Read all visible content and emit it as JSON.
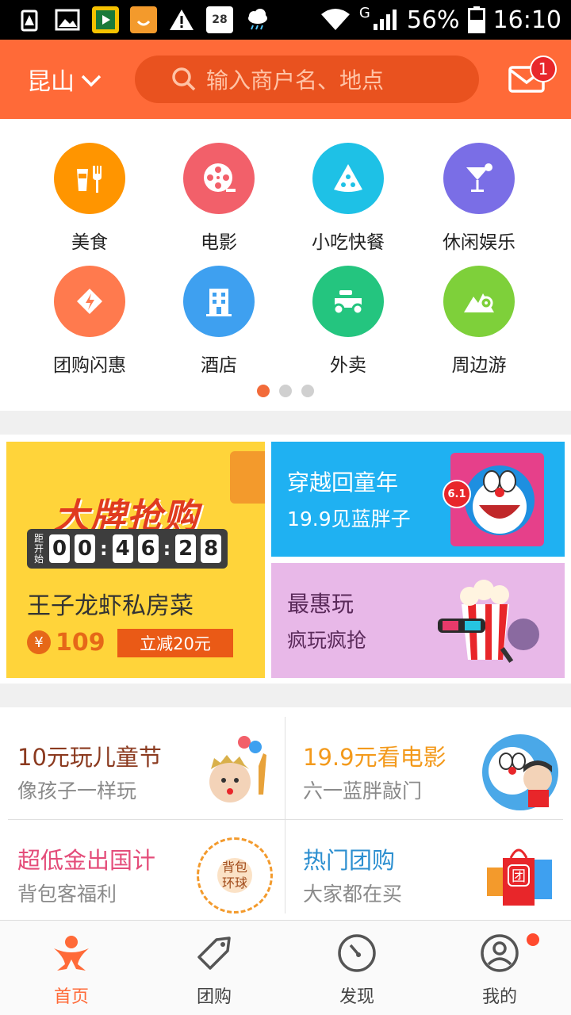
{
  "status_bar": {
    "signal": "G",
    "battery": "56%",
    "time": "16:10"
  },
  "header": {
    "city": "昆山",
    "search_placeholder": "输入商户名、地点",
    "mail_badge": "1"
  },
  "categories": [
    {
      "label": "美食",
      "icon": "food-icon",
      "color": "#ff9500"
    },
    {
      "label": "电影",
      "icon": "film-reel-icon",
      "color": "#f2606a"
    },
    {
      "label": "小吃快餐",
      "icon": "pizza-icon",
      "color": "#1ec1e6"
    },
    {
      "label": "休闲娱乐",
      "icon": "cocktail-icon",
      "color": "#7a6ee6"
    },
    {
      "label": "团购闪惠",
      "icon": "flash-tag-icon",
      "color": "#ff7a4e"
    },
    {
      "label": "酒店",
      "icon": "hotel-icon",
      "color": "#3ea0f0"
    },
    {
      "label": "外卖",
      "icon": "scooter-icon",
      "color": "#24c57f"
    },
    {
      "label": "周边游",
      "icon": "mountain-pin-icon",
      "color": "#7ed03a"
    }
  ],
  "pager": {
    "pages": 3,
    "active": 1
  },
  "promo": {
    "flash": {
      "title": "大牌抢购",
      "timer_label": "距开始",
      "hours": [
        "0",
        "0"
      ],
      "minutes": [
        "4",
        "6"
      ],
      "seconds": [
        "2",
        "8"
      ],
      "dish": "王子龙虾私房菜",
      "currency": "¥",
      "price": "109",
      "discount": "立减20元"
    },
    "blue": {
      "title": "穿越回童年",
      "subtitle": "19.9见蓝胖子",
      "badge": "6.1"
    },
    "pink": {
      "title": "最惠玩",
      "subtitle": "疯玩疯抢"
    }
  },
  "grid": [
    {
      "title": "10元玩儿童节",
      "subtitle": "像孩子一样玩",
      "title_color": "#8b3a1f"
    },
    {
      "title": "19.9元看电影",
      "subtitle": "六一蓝胖敲门",
      "title_color": "#f39a1c"
    },
    {
      "title": "超低金出国计",
      "subtitle": "背包客福利",
      "title_color": "#e44d7a",
      "image_text": "背包环球"
    },
    {
      "title": "热门团购",
      "subtitle": "大家都在买",
      "title_color": "#2c8fd0",
      "image_text": "团"
    }
  ],
  "tabs": [
    {
      "label": "首页",
      "icon": "home-person-icon",
      "active": true
    },
    {
      "label": "团购",
      "icon": "tag-icon",
      "active": false
    },
    {
      "label": "发现",
      "icon": "compass-icon",
      "active": false
    },
    {
      "label": "我的",
      "icon": "profile-icon",
      "active": false
    }
  ]
}
